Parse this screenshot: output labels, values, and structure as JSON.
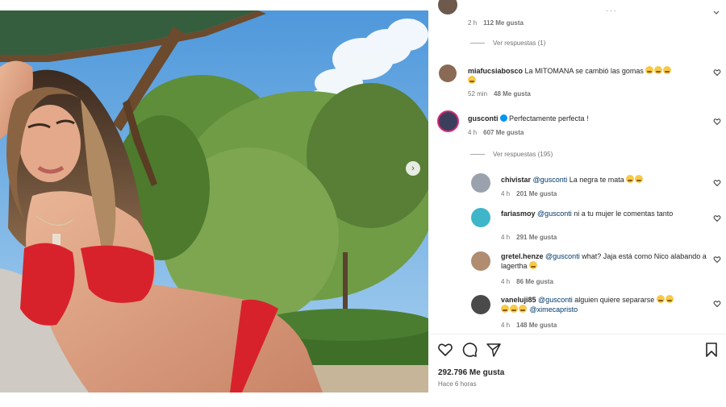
{
  "photo": {
    "next_icon": "chevron-right-icon"
  },
  "comments": [
    {
      "id": "c0",
      "text_partial": "· · ·",
      "time": "2 h",
      "likes": "112 Me gusta",
      "replies": "Ver respuestas (1)"
    },
    {
      "id": "c1",
      "username": "miafucsiabosco",
      "text": "La MITOMANA se cambió las gomas",
      "time": "52 min",
      "likes": "48 Me gusta"
    },
    {
      "id": "c2",
      "username": "gusconti",
      "verified": true,
      "text": "Perfectamente perfecta !",
      "time": "4 h",
      "likes": "607 Me gusta",
      "replies": "Ver respuestas (195)"
    },
    {
      "id": "r1",
      "username": "chivistar",
      "mention": "@gusconti",
      "text": "La negra te mata",
      "time": "4 h",
      "likes": "201 Me gusta"
    },
    {
      "id": "r2",
      "username": "fariasmoy",
      "mention": "@gusconti",
      "text": "ni a tu mujer le comentas tanto",
      "time": "4 h",
      "likes": "291 Me gusta"
    },
    {
      "id": "r3",
      "username": "gretel.henze",
      "mention": "@gusconti",
      "text": "what? Jaja está como Nico alabando a lagertha",
      "time": "4 h",
      "likes": "86 Me gusta"
    },
    {
      "id": "r4",
      "username": "vaneluji85",
      "mention": "@gusconti",
      "text": "alguien quiere separarse",
      "mention2": "@ximecapristo",
      "time": "4 h",
      "likes": "148 Me gusta"
    }
  ],
  "actions": {
    "like_icon": "heart-icon",
    "comment_icon": "comment-icon",
    "share_icon": "send-icon",
    "save_icon": "bookmark-icon"
  },
  "likes_total": "292.796 Me gusta",
  "posted": "Hace 6 horas",
  "colors": {
    "mention": "#00376b",
    "verified": "#0095f6",
    "meta": "#737373"
  }
}
